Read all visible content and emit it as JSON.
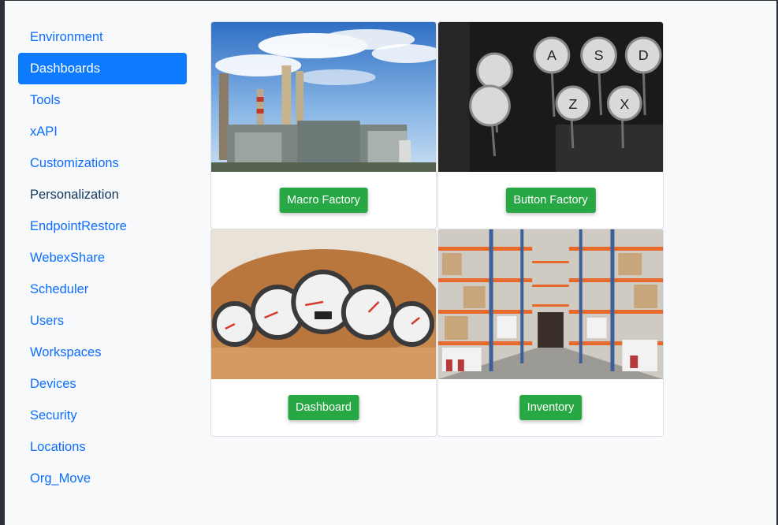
{
  "sidebar": {
    "items": [
      {
        "label": "Environment"
      },
      {
        "label": "Dashboards"
      },
      {
        "label": "Tools"
      },
      {
        "label": "xAPI"
      },
      {
        "label": "Customizations"
      },
      {
        "label": "Personalization"
      },
      {
        "label": "EndpointRestore"
      },
      {
        "label": "WebexShare"
      },
      {
        "label": "Scheduler"
      },
      {
        "label": "Users"
      },
      {
        "label": "Workspaces"
      },
      {
        "label": "Devices"
      },
      {
        "label": "Security"
      },
      {
        "label": "Locations"
      },
      {
        "label": "Org_Move"
      }
    ],
    "active_item": "Dashboards"
  },
  "cards": [
    {
      "button_label": "Macro Factory",
      "image": "factory-smokestacks-photo"
    },
    {
      "button_label": "Button Factory",
      "image": "typewriter-keys-photo"
    },
    {
      "button_label": "Dashboard",
      "image": "car-dashboard-gauges-photo"
    },
    {
      "button_label": "Inventory",
      "image": "warehouse-shelves-photo"
    }
  ],
  "colors": {
    "accent": "#0d7bff",
    "link": "#0d6efd",
    "button": "#28a745",
    "background": "#f8f9fa"
  }
}
